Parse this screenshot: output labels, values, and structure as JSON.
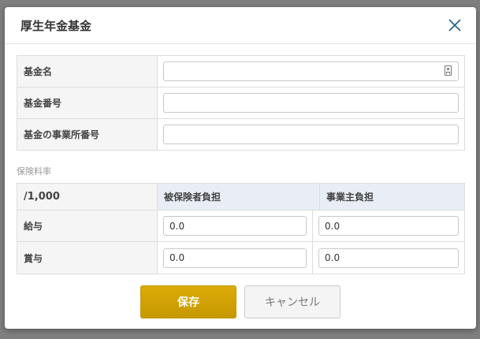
{
  "dialog": {
    "title": "厚生年金基金"
  },
  "fund_form": {
    "fields": [
      {
        "label": "基金名",
        "value": ""
      },
      {
        "label": "基金番号",
        "value": ""
      },
      {
        "label": "基金の事業所番号",
        "value": ""
      }
    ]
  },
  "insurance_rate": {
    "section_label": "保険料率",
    "unit_label": "/1,000",
    "columns": [
      "被保険者負担",
      "事業主負担"
    ],
    "rows": [
      {
        "label": "給与",
        "insured": "0.0",
        "employer": "0.0"
      },
      {
        "label": "賞与",
        "insured": "0.0",
        "employer": "0.0"
      }
    ]
  },
  "buttons": {
    "save": "保存",
    "cancel": "キャンセル"
  },
  "icons": {
    "close": "close-icon",
    "contact_card": "contact-card-icon"
  },
  "colors": {
    "primary_button": "#c69800",
    "header_cell": "#e9eef6",
    "label_cell": "#f5f5f5"
  }
}
